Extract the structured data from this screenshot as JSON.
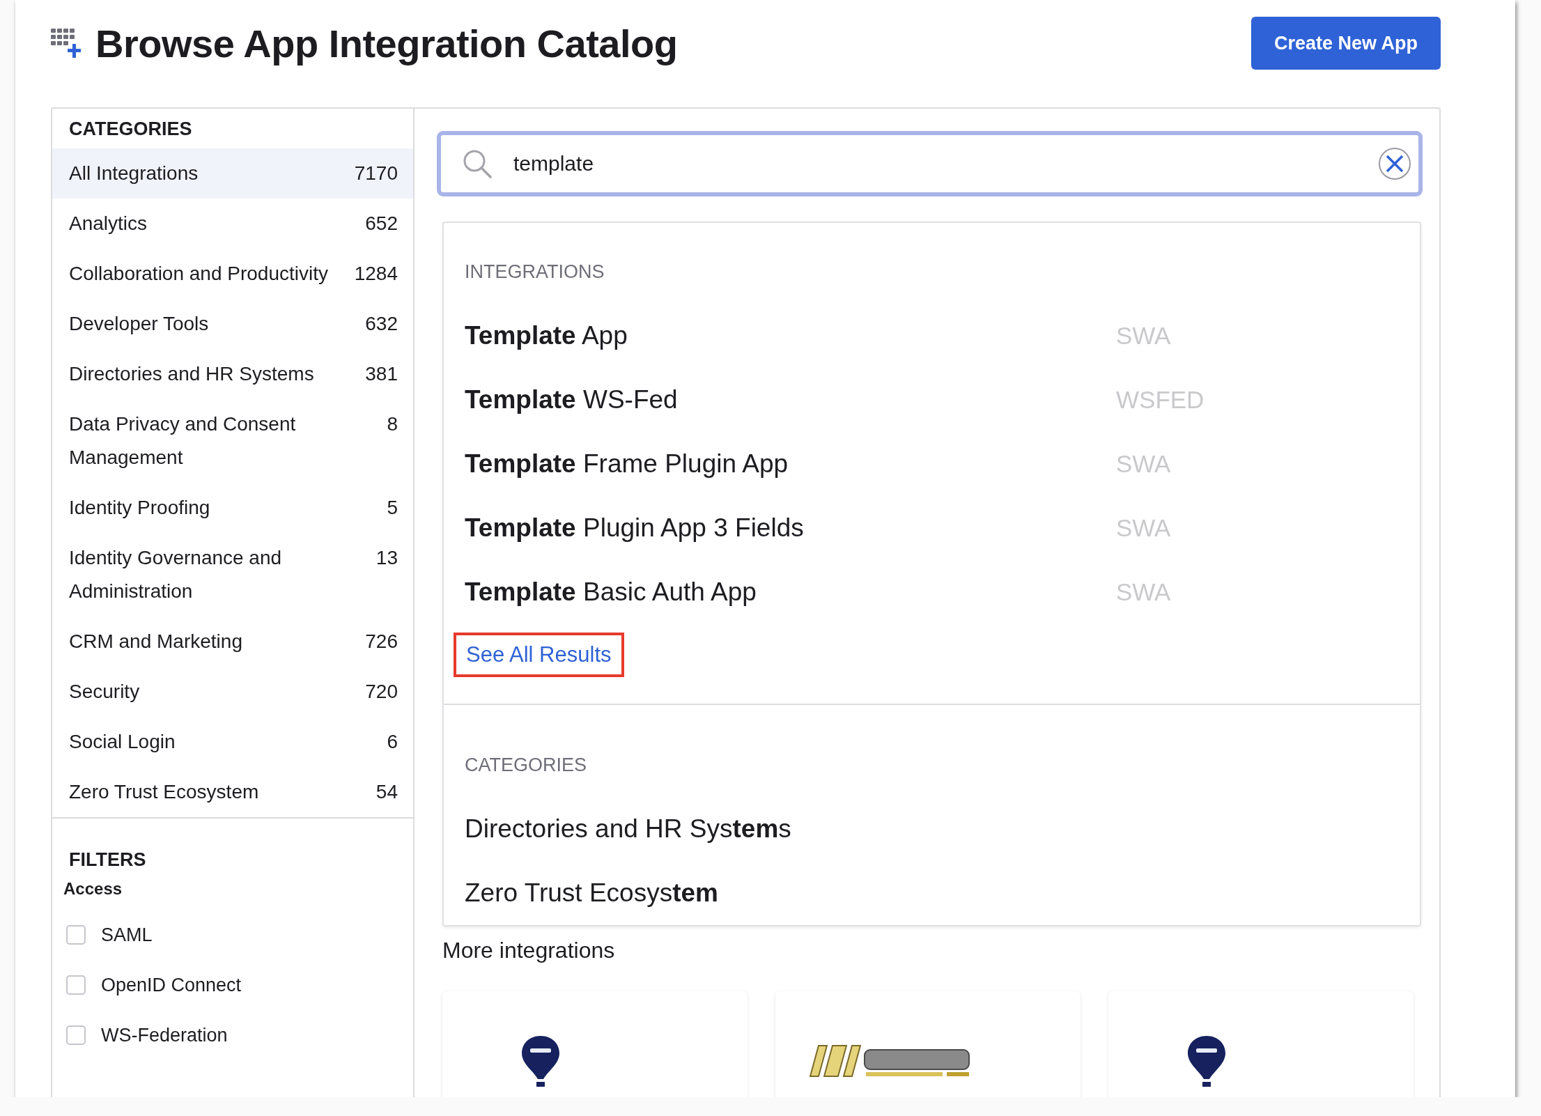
{
  "header": {
    "title": "Browse App Integration Catalog",
    "create_button": "Create New App"
  },
  "sidebar": {
    "categories_heading": "CATEGORIES",
    "categories": [
      {
        "label": "All Integrations",
        "count": "7170",
        "selected": true
      },
      {
        "label": "Analytics",
        "count": "652",
        "selected": false
      },
      {
        "label": "Collaboration and Productivity",
        "count": "1284",
        "selected": false
      },
      {
        "label": "Developer Tools",
        "count": "632",
        "selected": false
      },
      {
        "label": "Directories and HR Systems",
        "count": "381",
        "selected": false
      },
      {
        "label": "Data Privacy and Consent Management",
        "count": "8",
        "selected": false
      },
      {
        "label": "Identity Proofing",
        "count": "5",
        "selected": false
      },
      {
        "label": "Identity Governance and Administration",
        "count": "13",
        "selected": false
      },
      {
        "label": "CRM and Marketing",
        "count": "726",
        "selected": false
      },
      {
        "label": "Security",
        "count": "720",
        "selected": false
      },
      {
        "label": "Social Login",
        "count": "6",
        "selected": false
      },
      {
        "label": "Zero Trust Ecosystem",
        "count": "54",
        "selected": false
      }
    ],
    "filters_heading": "FILTERS",
    "filter_group": {
      "label": "Access",
      "options": [
        {
          "label": "SAML",
          "checked": false
        },
        {
          "label": "OpenID Connect",
          "checked": false
        },
        {
          "label": "WS-Federation",
          "checked": false
        }
      ]
    }
  },
  "search": {
    "value": "template"
  },
  "dropdown": {
    "integrations_heading": "INTEGRATIONS",
    "integrations": [
      {
        "name": "**Template** App",
        "protocol": "SWA"
      },
      {
        "name": "**Template** WS-Fed",
        "protocol": "WSFED"
      },
      {
        "name": "**Template** Frame Plugin App",
        "protocol": "SWA"
      },
      {
        "name": "**Template** Plugin App 3 Fields",
        "protocol": "SWA"
      },
      {
        "name": "**Template** Basic Auth App",
        "protocol": "SWA"
      }
    ],
    "see_all": {
      "label": "See All Results",
      "highlighted": true
    },
    "categories_heading": "CATEGORIES",
    "categories": [
      {
        "name": "Directories and HR Sys**tem**s"
      },
      {
        "name": "Zero Trust Ecosys**tem**"
      }
    ]
  },
  "more": {
    "heading": "More integrations",
    "cards": [
      {
        "kind": "balloon"
      },
      {
        "kind": "domain"
      },
      {
        "kind": "balloon"
      }
    ]
  }
}
